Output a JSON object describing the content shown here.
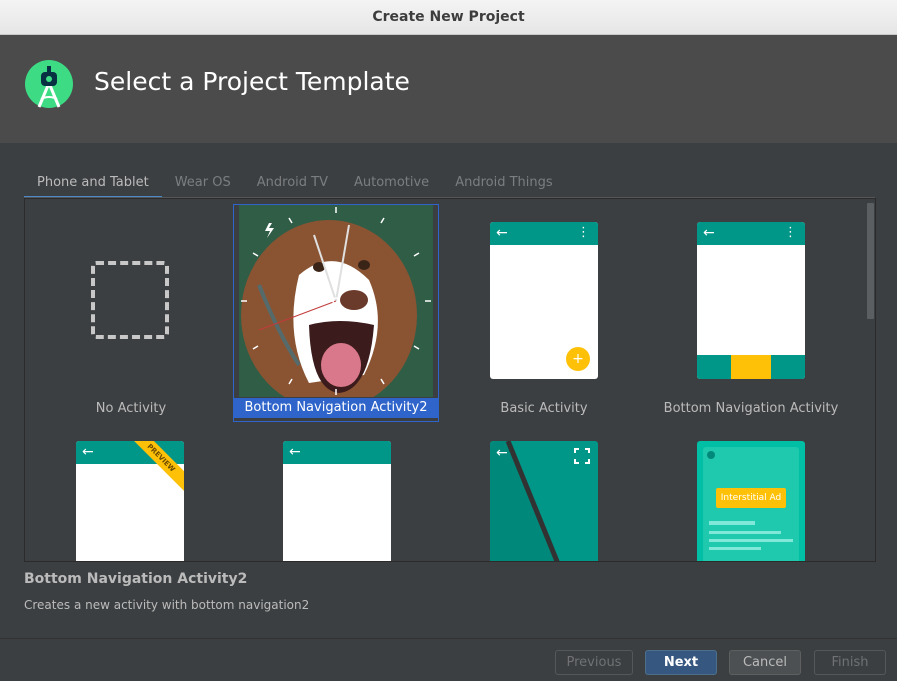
{
  "window": {
    "title": "Create New Project"
  },
  "header": {
    "title": "Select a Project Template",
    "logo_icon": "android-studio-logo-icon"
  },
  "tabs": [
    {
      "label": "Phone and Tablet",
      "active": true
    },
    {
      "label": "Wear OS"
    },
    {
      "label": "Android TV"
    },
    {
      "label": "Automotive"
    },
    {
      "label": "Android Things"
    }
  ],
  "templates": [
    {
      "label": "No Activity"
    },
    {
      "label": "Bottom Navigation Activity2",
      "selected": true
    },
    {
      "label": "Basic Activity"
    },
    {
      "label": "Bottom Navigation Activity"
    },
    {
      "label": "",
      "badge": "PREVIEW"
    },
    {
      "label": ""
    },
    {
      "label": ""
    },
    {
      "label": "",
      "ad_label": "Interstitial Ad"
    }
  ],
  "selection": {
    "title": "Bottom Navigation Activity2",
    "description": "Creates a new activity with bottom navigation2"
  },
  "buttons": {
    "previous": "Previous",
    "next": "Next",
    "cancel": "Cancel",
    "finish": "Finish"
  },
  "colors": {
    "accent": "#009688",
    "fab": "#ffc107",
    "selection": "#2f65ca",
    "primary_button": "#365880"
  }
}
